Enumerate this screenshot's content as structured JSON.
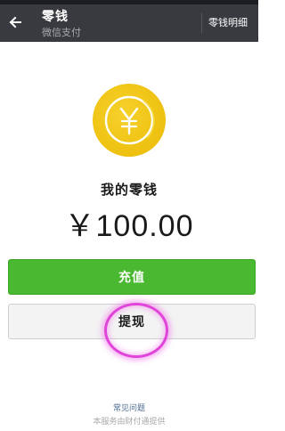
{
  "header": {
    "title": "零钱",
    "subtitle": "微信支付",
    "action_label": "零钱明细",
    "back_icon": "back-arrow-icon"
  },
  "wallet": {
    "coin_icon": "yen-coin-icon",
    "label": "我的零钱",
    "balance": "￥100.00"
  },
  "buttons": {
    "recharge_label": "充值",
    "withdraw_label": "提现"
  },
  "footer": {
    "faq_label": "常见问题",
    "service_note": "本服务由财付通提供"
  },
  "colors": {
    "appbar": "#393a3f",
    "primary_green": "#4ab830",
    "coin_gold": "#efc313",
    "highlight_pink": "#e044d8",
    "link_blue": "#4d6a91"
  }
}
